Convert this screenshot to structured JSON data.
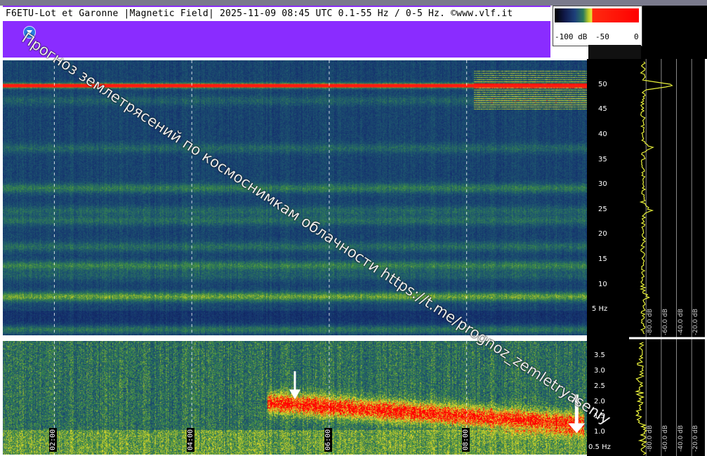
{
  "header": {
    "title": "F6ETU-Lot et Garonne |Magnetic Field| 2025-11-09 08:45 UTC 0.1-55 Hz / 0-5 Hz. ©www.vlf.it"
  },
  "colorbar": {
    "labels": [
      "-100 dB",
      "-50",
      "0"
    ],
    "min_db": -100,
    "max_db": 0
  },
  "watermark": {
    "text": "Прогноз землетрясений по космоснимкам облачности  https://t.me/prognoz_zemletryaseniy"
  },
  "colors": {
    "header_bg": "#8a2cff",
    "spectrogram_bg": "#1a3a6a",
    "mains_line": "#ff1a10",
    "profile_trace": "#e8f03a",
    "arrows": "#ffffff"
  },
  "chart_data": [
    {
      "type": "heatmap",
      "name": "upper-spectrogram",
      "title": "",
      "xlabel": "",
      "ylabel": "",
      "ylim": [
        0,
        55
      ],
      "y_ticks": [
        {
          "value": 50,
          "label": "50"
        },
        {
          "value": 45,
          "label": "45"
        },
        {
          "value": 40,
          "label": "40"
        },
        {
          "value": 35,
          "label": "35"
        },
        {
          "value": 30,
          "label": "30"
        },
        {
          "value": 25,
          "label": "25"
        },
        {
          "value": 20,
          "label": "20"
        },
        {
          "value": 15,
          "label": "15"
        },
        {
          "value": 10,
          "label": "10"
        },
        {
          "value": 5,
          "label": "5 Hz"
        }
      ],
      "time_grid_hours": [
        1.0,
        3.0,
        5.0,
        7.0
      ],
      "time_range_hours": [
        0.25,
        8.75
      ],
      "bands": [
        {
          "hz": 50,
          "intensity": 1.0
        },
        {
          "hz": 47,
          "intensity": 0.25
        },
        {
          "hz": 37.5,
          "intensity": 0.3
        },
        {
          "hz": 29.5,
          "intensity": 0.45
        },
        {
          "hz": 25,
          "intensity": 0.3
        },
        {
          "hz": 23,
          "intensity": 0.35
        },
        {
          "hz": 17.8,
          "intensity": 0.35
        },
        {
          "hz": 14,
          "intensity": 0.5
        },
        {
          "hz": 12,
          "intensity": 0.25
        },
        {
          "hz": 7.8,
          "intensity": 0.7
        },
        {
          "hz": 1.2,
          "intensity": 0.6
        }
      ],
      "grid": true
    },
    {
      "type": "heatmap",
      "name": "lower-spectrogram",
      "title": "",
      "xlabel": "",
      "ylabel": "",
      "ylim": [
        0.3,
        4.0
      ],
      "y_ticks": [
        {
          "value": 3.5,
          "label": "3.5"
        },
        {
          "value": 3.0,
          "label": "3.0"
        },
        {
          "value": 2.5,
          "label": "2.5"
        },
        {
          "value": 2.0,
          "label": "2.0"
        },
        {
          "value": 1.5,
          "label": "1.5"
        },
        {
          "value": 1.0,
          "label": "1.0"
        },
        {
          "value": 0.5,
          "label": "0.5 Hz"
        }
      ],
      "x_ticks": [
        {
          "value": 2,
          "label": "02:00"
        },
        {
          "value": 4,
          "label": "04:00"
        },
        {
          "value": 6,
          "label": "06:00"
        },
        {
          "value": 8,
          "label": "08:00"
        }
      ],
      "time_range_hours": [
        0.25,
        8.75
      ],
      "event": {
        "start_hour": 4.1,
        "end_hour": 8.7,
        "peak_hz": 1.6
      },
      "arrows": [
        {
          "hour": 4.5,
          "hz": 2.1
        },
        {
          "hour": 8.6,
          "hz": 1.0
        }
      ],
      "grid": true
    },
    {
      "type": "line",
      "name": "amplitude-profile",
      "title": "",
      "x_ticks": [
        "-80.0 dB",
        "-60.0 dB",
        "-40.0 dB",
        "-20.0 dB"
      ],
      "x_ticks_lower": [
        "-80.0 dB",
        "-60.0 dB",
        "-40.0 dB",
        "-20.0 dB"
      ],
      "xlim": [
        -95,
        -10
      ],
      "peaks": [
        {
          "hz": 50,
          "db": -44
        },
        {
          "hz": 37.5,
          "db": -72
        },
        {
          "hz": 25,
          "db": -74
        },
        {
          "hz": 7.8,
          "db": -78
        }
      ],
      "grid": true
    }
  ]
}
